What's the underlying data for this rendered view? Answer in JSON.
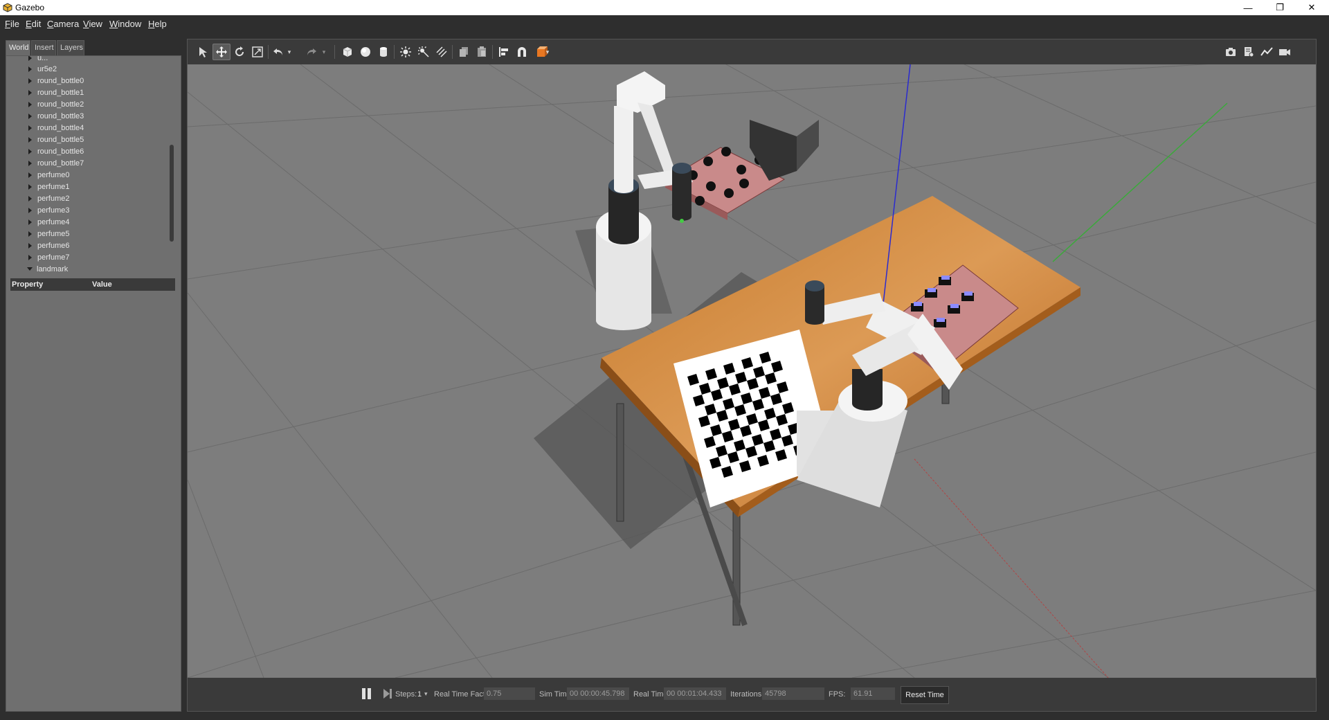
{
  "window": {
    "title": "Gazebo",
    "app_icon": "gazebo-logo-icon"
  },
  "menus": [
    "File",
    "Edit",
    "Camera",
    "View",
    "Window",
    "Help"
  ],
  "tabs": [
    "World",
    "Insert",
    "Layers"
  ],
  "tree": {
    "items": [
      {
        "label": "u...",
        "open": false
      },
      {
        "label": "ur5e2",
        "open": false
      },
      {
        "label": "round_bottle0",
        "open": false
      },
      {
        "label": "round_bottle1",
        "open": false
      },
      {
        "label": "round_bottle2",
        "open": false
      },
      {
        "label": "round_bottle3",
        "open": false
      },
      {
        "label": "round_bottle4",
        "open": false
      },
      {
        "label": "round_bottle5",
        "open": false
      },
      {
        "label": "round_bottle6",
        "open": false
      },
      {
        "label": "round_bottle7",
        "open": false
      },
      {
        "label": "perfume0",
        "open": false
      },
      {
        "label": "perfume1",
        "open": false
      },
      {
        "label": "perfume2",
        "open": false
      },
      {
        "label": "perfume3",
        "open": false
      },
      {
        "label": "perfume4",
        "open": false
      },
      {
        "label": "perfume5",
        "open": false
      },
      {
        "label": "perfume6",
        "open": false
      },
      {
        "label": "perfume7",
        "open": false
      },
      {
        "label": "landmark",
        "open": true
      }
    ]
  },
  "properties": {
    "col_property": "Property",
    "col_value": "Value"
  },
  "toolbar": {
    "icons": [
      "select-arrow-icon",
      "translate-icon",
      "rotate-icon",
      "scale-icon",
      "undo-icon",
      "undo-dropdown-icon",
      "redo-icon",
      "redo-dropdown-icon",
      "box-shape-icon",
      "sphere-shape-icon",
      "cylinder-shape-icon",
      "point-light-icon",
      "spot-light-icon",
      "directional-light-icon",
      "copy-icon",
      "paste-icon",
      "align-icon",
      "snap-icon",
      "view-angle-icon"
    ],
    "right_icons": [
      "screenshot-icon",
      "log-icon",
      "plot-icon",
      "video-record-icon"
    ]
  },
  "statusbar": {
    "steps_label": "Steps:",
    "steps_value": "1",
    "rtf_label": "Real Time Factor:",
    "rtf_value": "0.75",
    "sim_time_label": "Sim Time:",
    "sim_time_value": "00 00:00:45.798",
    "real_time_label": "Real Time:",
    "real_time_value": "00 00:01:04.433",
    "iterations_label": "Iterations:",
    "iterations_value": "45798",
    "fps_label": "FPS:",
    "fps_value": "61.91",
    "reset_label": "Reset Time"
  }
}
